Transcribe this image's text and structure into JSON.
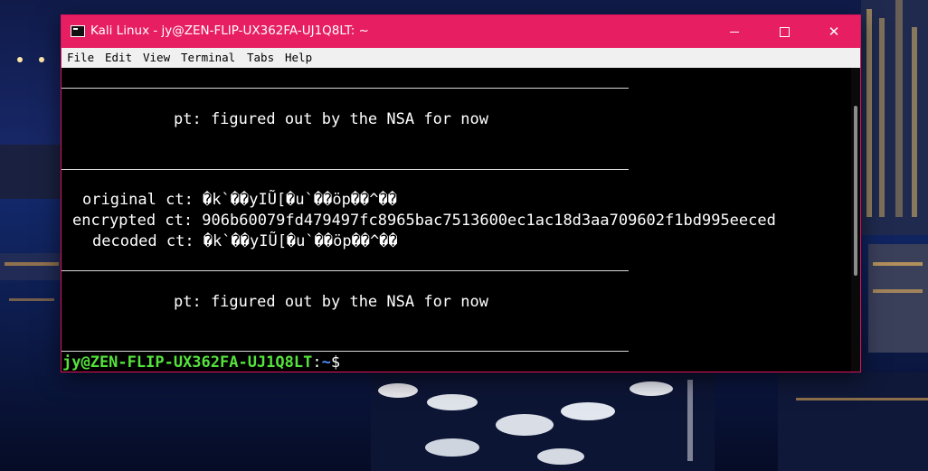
{
  "window": {
    "title": "Kali Linux - jy@ZEN-FLIP-UX362FA-UJ1Q8LT: ~",
    "accent": "#e81e63"
  },
  "menu": [
    "File",
    "Edit",
    "View",
    "Terminal",
    "Tabs",
    "Help"
  ],
  "terminal": {
    "pt_line_1": "pt: figured out by the NSA for now",
    "original_ct": "original ct: �k`��yIŨ[�u`��öp��^��",
    "encrypted_ct": "encrypted ct: 906b60079fd479497fc8965bac7513600ec1ac18d3aa709602f1bd995eeced",
    "decoded_ct": "decoded ct: �k`��yIŨ[�u`��öp��^��",
    "pt_line_2": "pt: figured out by the NSA for now",
    "prompt_user_host": "jy@ZEN-FLIP-UX362FA-UJ1Q8LT",
    "prompt_sep": ":",
    "prompt_path": "~",
    "prompt_symbol": "$"
  },
  "colors": {
    "prompt_user": "#55e33c",
    "prompt_path": "#4f8cff"
  }
}
